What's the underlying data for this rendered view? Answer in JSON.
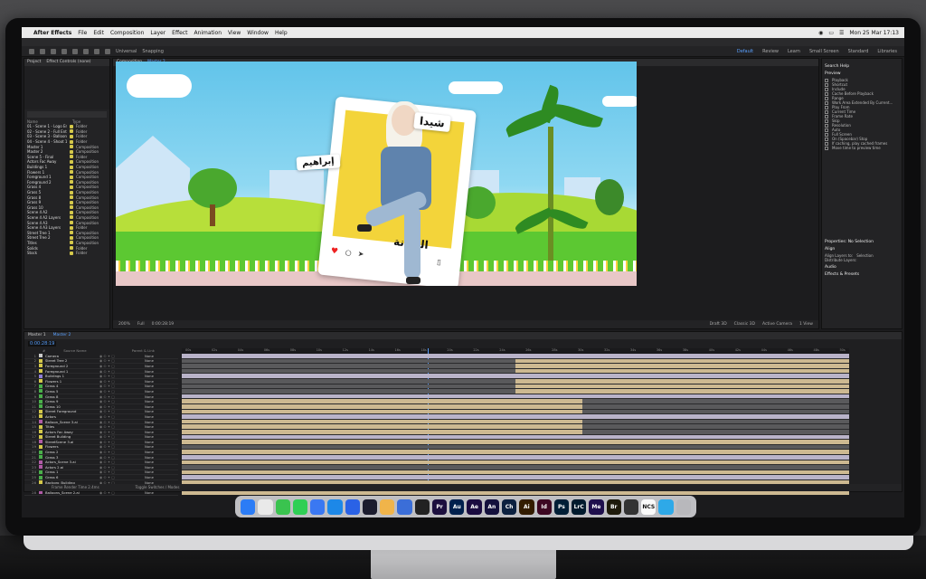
{
  "menubar": {
    "apple": "",
    "app_name": "After Effects",
    "items": [
      "File",
      "Edit",
      "Composition",
      "Layer",
      "Effect",
      "Animation",
      "View",
      "Window",
      "Help"
    ],
    "date_time": "Mon 25 Mar 17:13"
  },
  "toolbar": {
    "universal": "Universal",
    "snapping": "Snapping",
    "workspaces": [
      "Default",
      "Review",
      "Learn",
      "Small Screen",
      "Standard",
      "Libraries"
    ]
  },
  "project": {
    "tabs": [
      "Project",
      "Effect Controls (none)"
    ],
    "header": [
      "Name",
      "Type"
    ],
    "items": [
      {
        "name": "01 - Scene 1 - Logo Entry",
        "type": "Folder"
      },
      {
        "name": "02 - Scene 2 - Full Entry",
        "type": "Folder"
      },
      {
        "name": "03 - Scene 3 - Balloons",
        "type": "Folder"
      },
      {
        "name": "04 - Scene 4 - Shoot 1",
        "type": "Folder"
      },
      {
        "name": "Master 1",
        "type": "Composition"
      },
      {
        "name": "Master 2",
        "type": "Composition"
      },
      {
        "name": "Scene 5 - Final",
        "type": "Folder"
      },
      {
        "name": "Actors Fac Away",
        "type": "Composition"
      },
      {
        "name": "Buildings 1",
        "type": "Composition"
      },
      {
        "name": "Flowers 1",
        "type": "Composition"
      },
      {
        "name": "Foreground 1",
        "type": "Composition"
      },
      {
        "name": "Foreground 2",
        "type": "Composition"
      },
      {
        "name": "Grass 4",
        "type": "Composition"
      },
      {
        "name": "Grass 5",
        "type": "Composition"
      },
      {
        "name": "Grass 8",
        "type": "Composition"
      },
      {
        "name": "Grass 9",
        "type": "Composition"
      },
      {
        "name": "Grass 10",
        "type": "Composition"
      },
      {
        "name": "Scene 4 A2",
        "type": "Composition"
      },
      {
        "name": "Scene 4 A2 Layers",
        "type": "Composition"
      },
      {
        "name": "Scene 4 A3",
        "type": "Composition"
      },
      {
        "name": "Scene 4 A3 Layers",
        "type": "Folder"
      },
      {
        "name": "Street Tree 1",
        "type": "Composition"
      },
      {
        "name": "Street Tree 2",
        "type": "Composition"
      },
      {
        "name": "Titles",
        "type": "Composition"
      },
      {
        "name": "Solids",
        "type": "Folder"
      },
      {
        "name": "Stock",
        "type": "Folder"
      }
    ]
  },
  "viewer": {
    "tabs": [
      "Composition",
      "Master 2"
    ],
    "subtabs": [
      "Master 2",
      "Actors",
      "Flash Actor 4"
    ],
    "camera": "Active Camera (Camera)",
    "footer_left": [
      "200%",
      "Full",
      "0:00:28:19"
    ],
    "footer_right": [
      "Draft 3D",
      "Classic 3D",
      "Active Camera",
      "1 View"
    ]
  },
  "canvas": {
    "tag_top": "شيدا",
    "tag_left": "إبراهيم",
    "card_name": "الفنانة"
  },
  "right_panel": {
    "title": "Preview",
    "search": "Search Help",
    "rows": [
      "Playback",
      "Shortcut",
      "Include",
      "Cache Before Playback",
      "Range",
      "Work Area Extended By Current...",
      "Play From",
      "Current Time",
      "Frame Rate",
      "Skip",
      "Resolution",
      "Auto",
      "Full Screen",
      "On (Spacebar) Stop",
      "If caching, play cached frames",
      "Move time to preview time"
    ],
    "properties": "Properties: No Selection",
    "align": "Align",
    "align_to": "Align Layers to:",
    "selection": "Selection",
    "distribute": "Distribute Layers:",
    "audio": "Audio",
    "effects": "Effects & Presets"
  },
  "timeline": {
    "tabs": [
      "Master 1",
      "Master 2"
    ],
    "timecode": "0:00:28:19",
    "header": [
      "#",
      "Source Name",
      "Parent & Link"
    ],
    "ruler": [
      "00s",
      "02s",
      "04s",
      "06s",
      "08s",
      "10s",
      "12s",
      "14s",
      "16s",
      "18s",
      "20s",
      "22s",
      "24s",
      "26s",
      "28s",
      "30s",
      "32s",
      "34s",
      "36s",
      "38s",
      "40s",
      "42s",
      "44s",
      "46s",
      "48s",
      "50s"
    ],
    "layers": [
      {
        "num": "1",
        "name": "Camera",
        "parent": "None"
      },
      {
        "num": "2",
        "name": "Street Tree 2",
        "parent": "None"
      },
      {
        "num": "3",
        "name": "Foreground 2",
        "parent": "None"
      },
      {
        "num": "4",
        "name": "Foreground 1",
        "parent": "None"
      },
      {
        "num": "5",
        "name": "Buildings 1",
        "parent": "None"
      },
      {
        "num": "6",
        "name": "Flowers 1",
        "parent": "None"
      },
      {
        "num": "7",
        "name": "Grass 4",
        "parent": "None"
      },
      {
        "num": "8",
        "name": "Grass 5",
        "parent": "None"
      },
      {
        "num": "9",
        "name": "Grass 8",
        "parent": "None"
      },
      {
        "num": "10",
        "name": "Grass 9",
        "parent": "None"
      },
      {
        "num": "11",
        "name": "Grass 10",
        "parent": "None"
      },
      {
        "num": "12",
        "name": "Street Foreground",
        "parent": "None"
      },
      {
        "num": "13",
        "name": "Actors",
        "parent": "None"
      },
      {
        "num": "14",
        "name": "Balloon_Scene 3.ai",
        "parent": "None"
      },
      {
        "num": "15",
        "name": "Titles",
        "parent": "None"
      },
      {
        "num": "16",
        "name": "Actors Fac Away",
        "parent": "None"
      },
      {
        "num": "17",
        "name": "Street Building",
        "parent": "None"
      },
      {
        "num": "18",
        "name": "StreetScene 3.ai",
        "parent": "None"
      },
      {
        "num": "19",
        "name": "Flowers",
        "parent": "None"
      },
      {
        "num": "20",
        "name": "Grass 2",
        "parent": "None"
      },
      {
        "num": "21",
        "name": "Grass 3",
        "parent": "None"
      },
      {
        "num": "22",
        "name": "Actors_Scene 3.ai",
        "parent": "None"
      },
      {
        "num": "23",
        "name": "Actors 2.ai",
        "parent": "None"
      },
      {
        "num": "24",
        "name": "Grass 1",
        "parent": "None"
      },
      {
        "num": "25",
        "name": "Grass 6",
        "parent": "None"
      },
      {
        "num": "26",
        "name": "Backgro_Building",
        "parent": "None"
      },
      {
        "num": "27",
        "name": "Balloon_Scene 2.ai",
        "parent": "None"
      },
      {
        "num": "28",
        "name": "Balloons_Scene 2.ai",
        "parent": "None"
      }
    ],
    "footer": [
      "Frame Render Time 2.4ms",
      "Toggle Switches / Modes"
    ]
  },
  "dock": {
    "apps": [
      {
        "label": "",
        "color": "#2b7cf6"
      },
      {
        "label": "",
        "color": "#e9e9e9"
      },
      {
        "label": "",
        "color": "#3ac34f"
      },
      {
        "label": "",
        "color": "#2fcf55"
      },
      {
        "label": "",
        "color": "#3a78f2"
      },
      {
        "label": "",
        "color": "#1d88e8"
      },
      {
        "label": "",
        "color": "#2a62e6"
      },
      {
        "label": "",
        "color": "#1c1c2e"
      },
      {
        "label": "",
        "color": "#f0b44a"
      },
      {
        "label": "",
        "color": "#3b6ed8"
      },
      {
        "label": "",
        "color": "#222"
      },
      {
        "label": "Pr",
        "color": "#1c0f3e"
      },
      {
        "label": "Au",
        "color": "#00204d"
      },
      {
        "label": "Ae",
        "color": "#1a0b40"
      },
      {
        "label": "An",
        "color": "#14103d"
      },
      {
        "label": "Ch",
        "color": "#0c2140"
      },
      {
        "label": "Ai",
        "color": "#331c00"
      },
      {
        "label": "Id",
        "color": "#3d0722"
      },
      {
        "label": "Ps",
        "color": "#001e36"
      },
      {
        "label": "LrC",
        "color": "#001a2d"
      },
      {
        "label": "Me",
        "color": "#1f0f4d"
      },
      {
        "label": "Br",
        "color": "#1e1a0b"
      },
      {
        "label": "",
        "color": "#333"
      },
      {
        "label": "NCS",
        "color": "#fafafa"
      },
      {
        "label": "",
        "color": "#2ea9e8"
      },
      {
        "label": "",
        "color": "#b8b8bc"
      }
    ]
  }
}
